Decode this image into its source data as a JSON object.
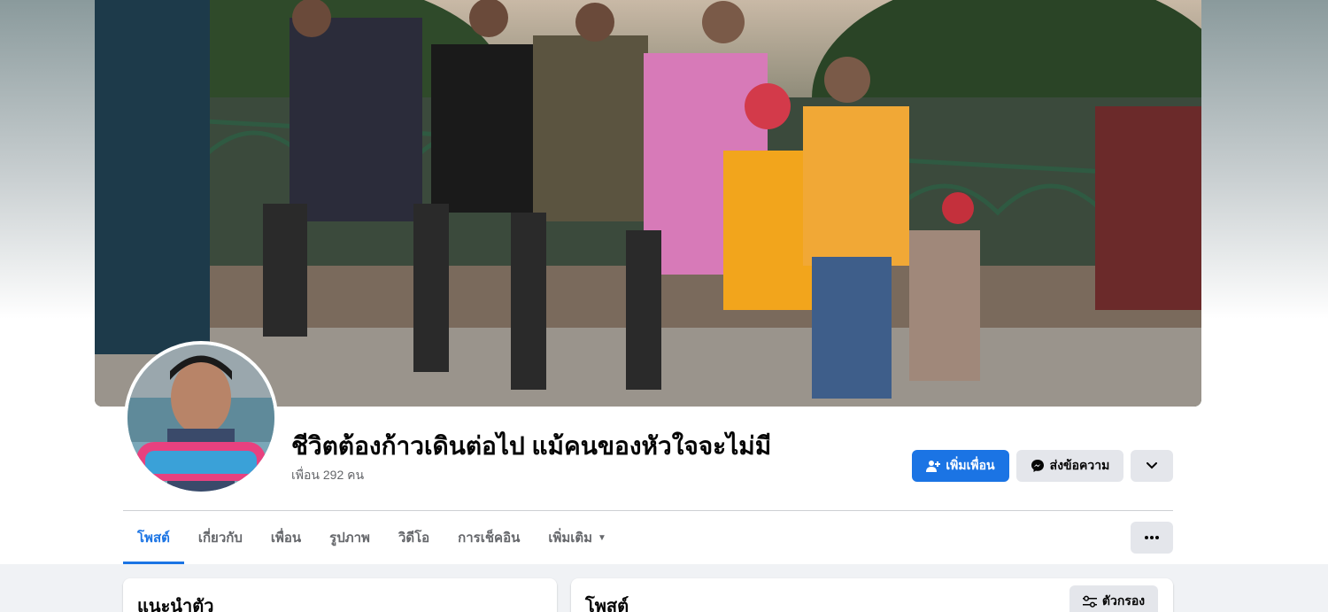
{
  "profile": {
    "name": "ชีวิตต้องก้าวเดินต่อไป แม้คนของหัวใจจะไม่มี",
    "friends_count": "เพื่อน 292 คน"
  },
  "actions": {
    "add_friend_label": "เพิ่มเพื่อน",
    "message_label": "ส่งข้อความ"
  },
  "tabs": [
    {
      "label": "โพสต์",
      "active": true
    },
    {
      "label": "เกี่ยวกับ",
      "active": false
    },
    {
      "label": "เพื่อน",
      "active": false
    },
    {
      "label": "รูปภาพ",
      "active": false
    },
    {
      "label": "วิดีโอ",
      "active": false
    },
    {
      "label": "การเช็คอิน",
      "active": false
    },
    {
      "label": "เพิ่มเติม",
      "active": false
    }
  ],
  "cards": {
    "intro_title": "แนะนำตัว",
    "posts_title": "โพสต์",
    "filter_label": "ตัวกรอง"
  },
  "colors": {
    "accent": "#1b74e4",
    "secondary_button": "#e4e6eb",
    "page_background": "#f0f2f5"
  },
  "icons": {
    "add_friend": "person-plus-icon",
    "message": "messenger-icon",
    "more": "chevron-down-icon",
    "tab_more": "caret-down-icon",
    "menu": "more-dots-icon",
    "filter": "sliders-icon"
  }
}
